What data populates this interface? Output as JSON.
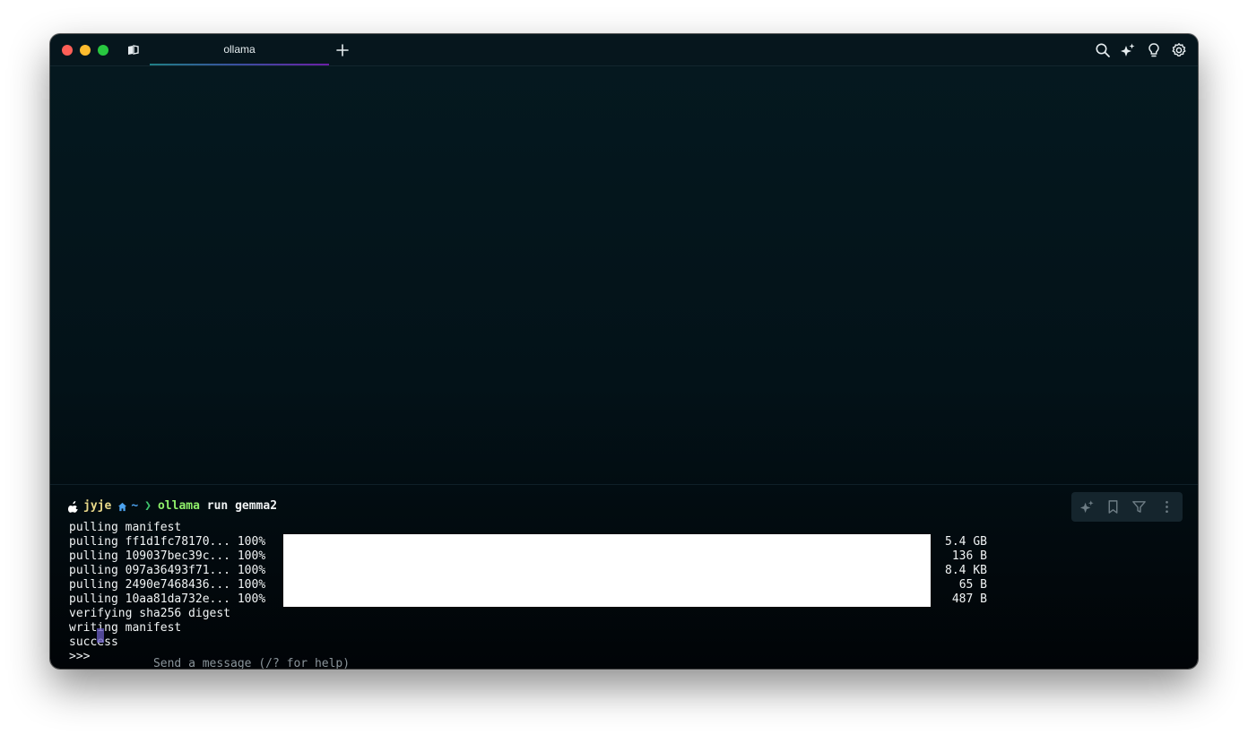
{
  "window": {
    "tab_title": "ollama"
  },
  "toolbar_icons": [
    "search-icon",
    "ai-sparkle-icon",
    "lightbulb-icon",
    "settings-gear-icon"
  ],
  "prompt": {
    "user": "jyje",
    "dir": "~",
    "chevron": "❯",
    "command": "ollama",
    "args": " run gemma2"
  },
  "output": {
    "pulling_manifest": "pulling manifest",
    "layers": [
      {
        "label": "pulling ff1d1fc78170... 100%",
        "progress": 1.0,
        "size": "5.4 GB"
      },
      {
        "label": "pulling 109037bec39c... 100%",
        "progress": 1.0,
        "size": "136 B"
      },
      {
        "label": "pulling 097a36493f71... 100%",
        "progress": 1.0,
        "size": "8.4 KB"
      },
      {
        "label": "pulling 2490e7468436... 100%",
        "progress": 1.0,
        "size": "65 B"
      },
      {
        "label": "pulling 10aa81da732e... 100%",
        "progress": 1.0,
        "size": "487 B"
      }
    ],
    "verifying": "verifying sha256 digest",
    "writing": "writing manifest",
    "success": "success"
  },
  "input": {
    "prompt_symbol": ">>> ",
    "placeholder": "Send a message (/? for help)"
  },
  "colors": {
    "user": "#e9d98a",
    "dir": "#4da3f0",
    "chevron": "#3ec46d",
    "command": "#8ff06a",
    "cursor": "#6c5fc7"
  }
}
